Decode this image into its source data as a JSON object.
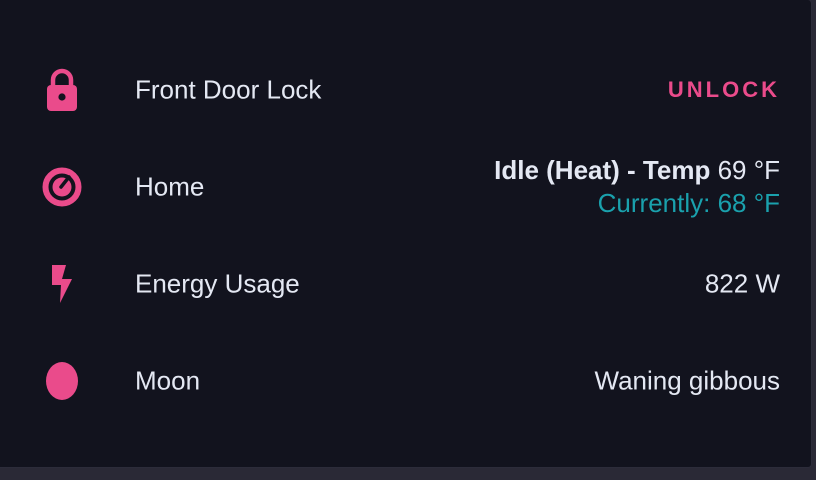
{
  "colors": {
    "accent": "#ea4b8b",
    "background": "#12131e",
    "text": "#e4e8f3",
    "current_temp": "#1aa1ad"
  },
  "entities": {
    "front_door": {
      "icon": "lock-icon",
      "name": "Front Door Lock",
      "action_label": "UNLOCK"
    },
    "home": {
      "icon": "thermostat-icon",
      "name": "Home",
      "mode": "Idle (Heat) - Temp",
      "target_temp": "69 °F",
      "current_temp": "Currently: 68 °F"
    },
    "energy": {
      "icon": "flash-icon",
      "name": "Energy Usage",
      "state": "822 W"
    },
    "moon": {
      "icon": "moon-waning-gibbous-icon",
      "name": "Moon",
      "state": "Waning gibbous"
    }
  }
}
